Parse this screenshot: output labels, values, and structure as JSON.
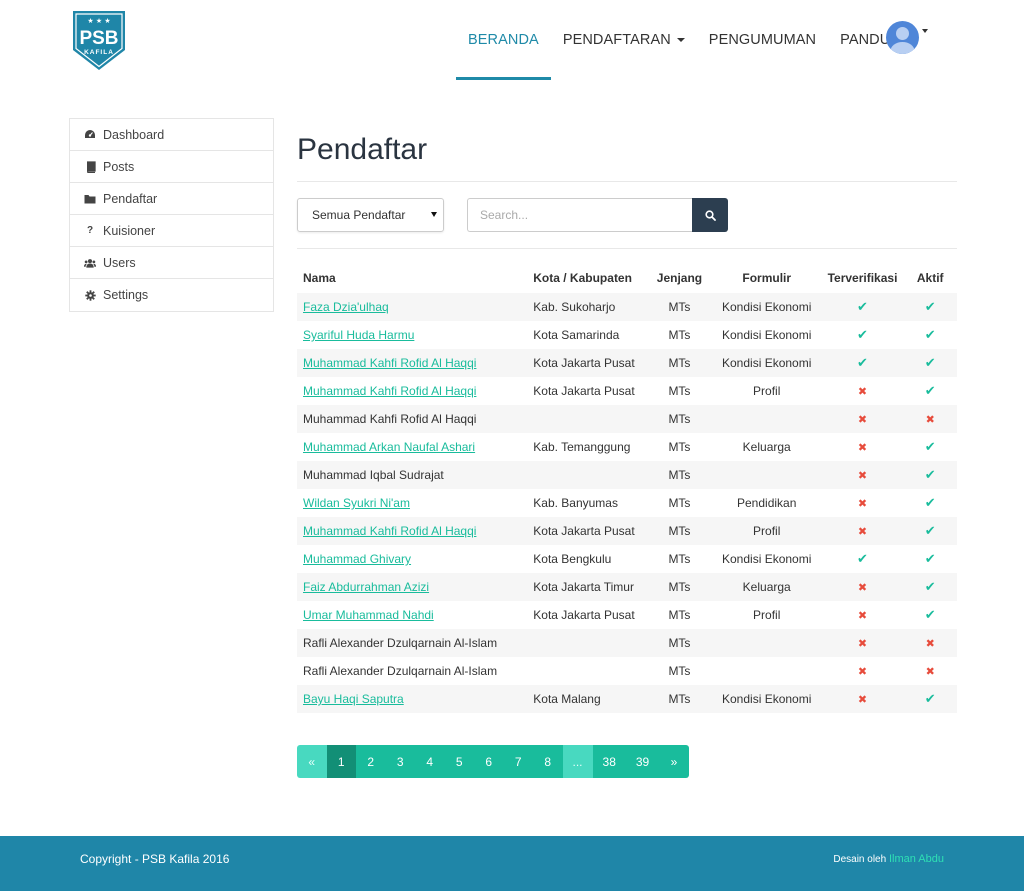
{
  "logo": {
    "text": "PSB",
    "subtext": "KAFILA",
    "stars": "★ ★ ★",
    "color": "#1f86a8"
  },
  "nav": {
    "items": [
      {
        "label": "BERANDA",
        "active": true
      },
      {
        "label": "PENDAFTARAN",
        "dropdown": true
      },
      {
        "label": "PENGUMUMAN"
      },
      {
        "label": "PANDUAN"
      }
    ]
  },
  "sidebar": {
    "items": [
      {
        "label": "Dashboard",
        "icon": "dashboard-icon"
      },
      {
        "label": "Posts",
        "icon": "book-icon"
      },
      {
        "label": "Pendaftar",
        "icon": "folder-icon"
      },
      {
        "label": "Kuisioner",
        "icon": "question-icon"
      },
      {
        "label": "Users",
        "icon": "users-icon"
      },
      {
        "label": "Settings",
        "icon": "gear-icon"
      }
    ]
  },
  "main": {
    "title": "Pendaftar",
    "filter": {
      "selected": "Semua Pendaftar"
    },
    "search": {
      "placeholder": "Search..."
    }
  },
  "table": {
    "headers": [
      "Nama",
      "Kota / Kabupaten",
      "Jenjang",
      "Formulir",
      "Terverifikasi",
      "Aktif"
    ],
    "rows": [
      {
        "nama": "Faza Dzia'ulhaq",
        "link": true,
        "kota": "Kab. Sukoharjo",
        "jenjang": "MTs",
        "formulir": "Kondisi Ekonomi",
        "verified": true,
        "active": true
      },
      {
        "nama": "Syariful Huda Harmu",
        "link": true,
        "kota": "Kota Samarinda",
        "jenjang": "MTs",
        "formulir": "Kondisi Ekonomi",
        "verified": true,
        "active": true
      },
      {
        "nama": "Muhammad Kahfi Rofid Al Haqqi",
        "link": true,
        "kota": "Kota Jakarta Pusat",
        "jenjang": "MTs",
        "formulir": "Kondisi Ekonomi",
        "verified": true,
        "active": true
      },
      {
        "nama": "Muhammad Kahfi Rofid Al Haqqi",
        "link": true,
        "kota": "Kota Jakarta Pusat",
        "jenjang": "MTs",
        "formulir": "Profil",
        "verified": false,
        "active": true
      },
      {
        "nama": "Muhammad Kahfi Rofid Al Haqqi",
        "link": false,
        "kota": "",
        "jenjang": "MTs",
        "formulir": "",
        "verified": false,
        "active": false
      },
      {
        "nama": "Muhammad Arkan Naufal Ashari",
        "link": true,
        "kota": "Kab. Temanggung",
        "jenjang": "MTs",
        "formulir": "Keluarga",
        "verified": false,
        "active": true
      },
      {
        "nama": "Muhammad Iqbal Sudrajat",
        "link": false,
        "kota": "",
        "jenjang": "MTs",
        "formulir": "",
        "verified": false,
        "active": true
      },
      {
        "nama": "Wildan Syukri Ni'am",
        "link": true,
        "kota": "Kab. Banyumas",
        "jenjang": "MTs",
        "formulir": "Pendidikan",
        "verified": false,
        "active": true
      },
      {
        "nama": "Muhammad Kahfi Rofid Al Haqqi",
        "link": true,
        "kota": "Kota Jakarta Pusat",
        "jenjang": "MTs",
        "formulir": "Profil",
        "verified": false,
        "active": true
      },
      {
        "nama": "Muhammad Ghivary",
        "link": true,
        "kota": "Kota Bengkulu",
        "jenjang": "MTs",
        "formulir": "Kondisi Ekonomi",
        "verified": true,
        "active": true
      },
      {
        "nama": "Faiz Abdurrahman Azizi",
        "link": true,
        "kota": "Kota Jakarta Timur",
        "jenjang": "MTs",
        "formulir": "Keluarga",
        "verified": false,
        "active": true
      },
      {
        "nama": "Umar Muhammad Nahdi",
        "link": true,
        "kota": "Kota Jakarta Pusat",
        "jenjang": "MTs",
        "formulir": "Profil",
        "verified": false,
        "active": true
      },
      {
        "nama": "Rafli Alexander Dzulqarnain Al-Islam",
        "link": false,
        "kota": "",
        "jenjang": "MTs",
        "formulir": "",
        "verified": false,
        "active": false
      },
      {
        "nama": "Rafli Alexander Dzulqarnain Al-Islam",
        "link": false,
        "kota": "",
        "jenjang": "MTs",
        "formulir": "",
        "verified": false,
        "active": false
      },
      {
        "nama": "Bayu Haqi Saputra",
        "link": true,
        "kota": "Kota Malang",
        "jenjang": "MTs",
        "formulir": "Kondisi Ekonomi",
        "verified": false,
        "active": true
      }
    ],
    "check_color": "#19bc9c",
    "cross_color": "#e74c3c"
  },
  "pagination": {
    "prev": "«",
    "pages": [
      "1",
      "2",
      "3",
      "4",
      "5",
      "6",
      "7",
      "8"
    ],
    "current": "1",
    "dots": "...",
    "last_pages": [
      "38",
      "39"
    ],
    "next": "»"
  },
  "footer": {
    "copyright": "Copyright - PSB Kafila 2016",
    "credit_prefix": "Desain oleh",
    "credit_name": "Ilman Abdu"
  }
}
